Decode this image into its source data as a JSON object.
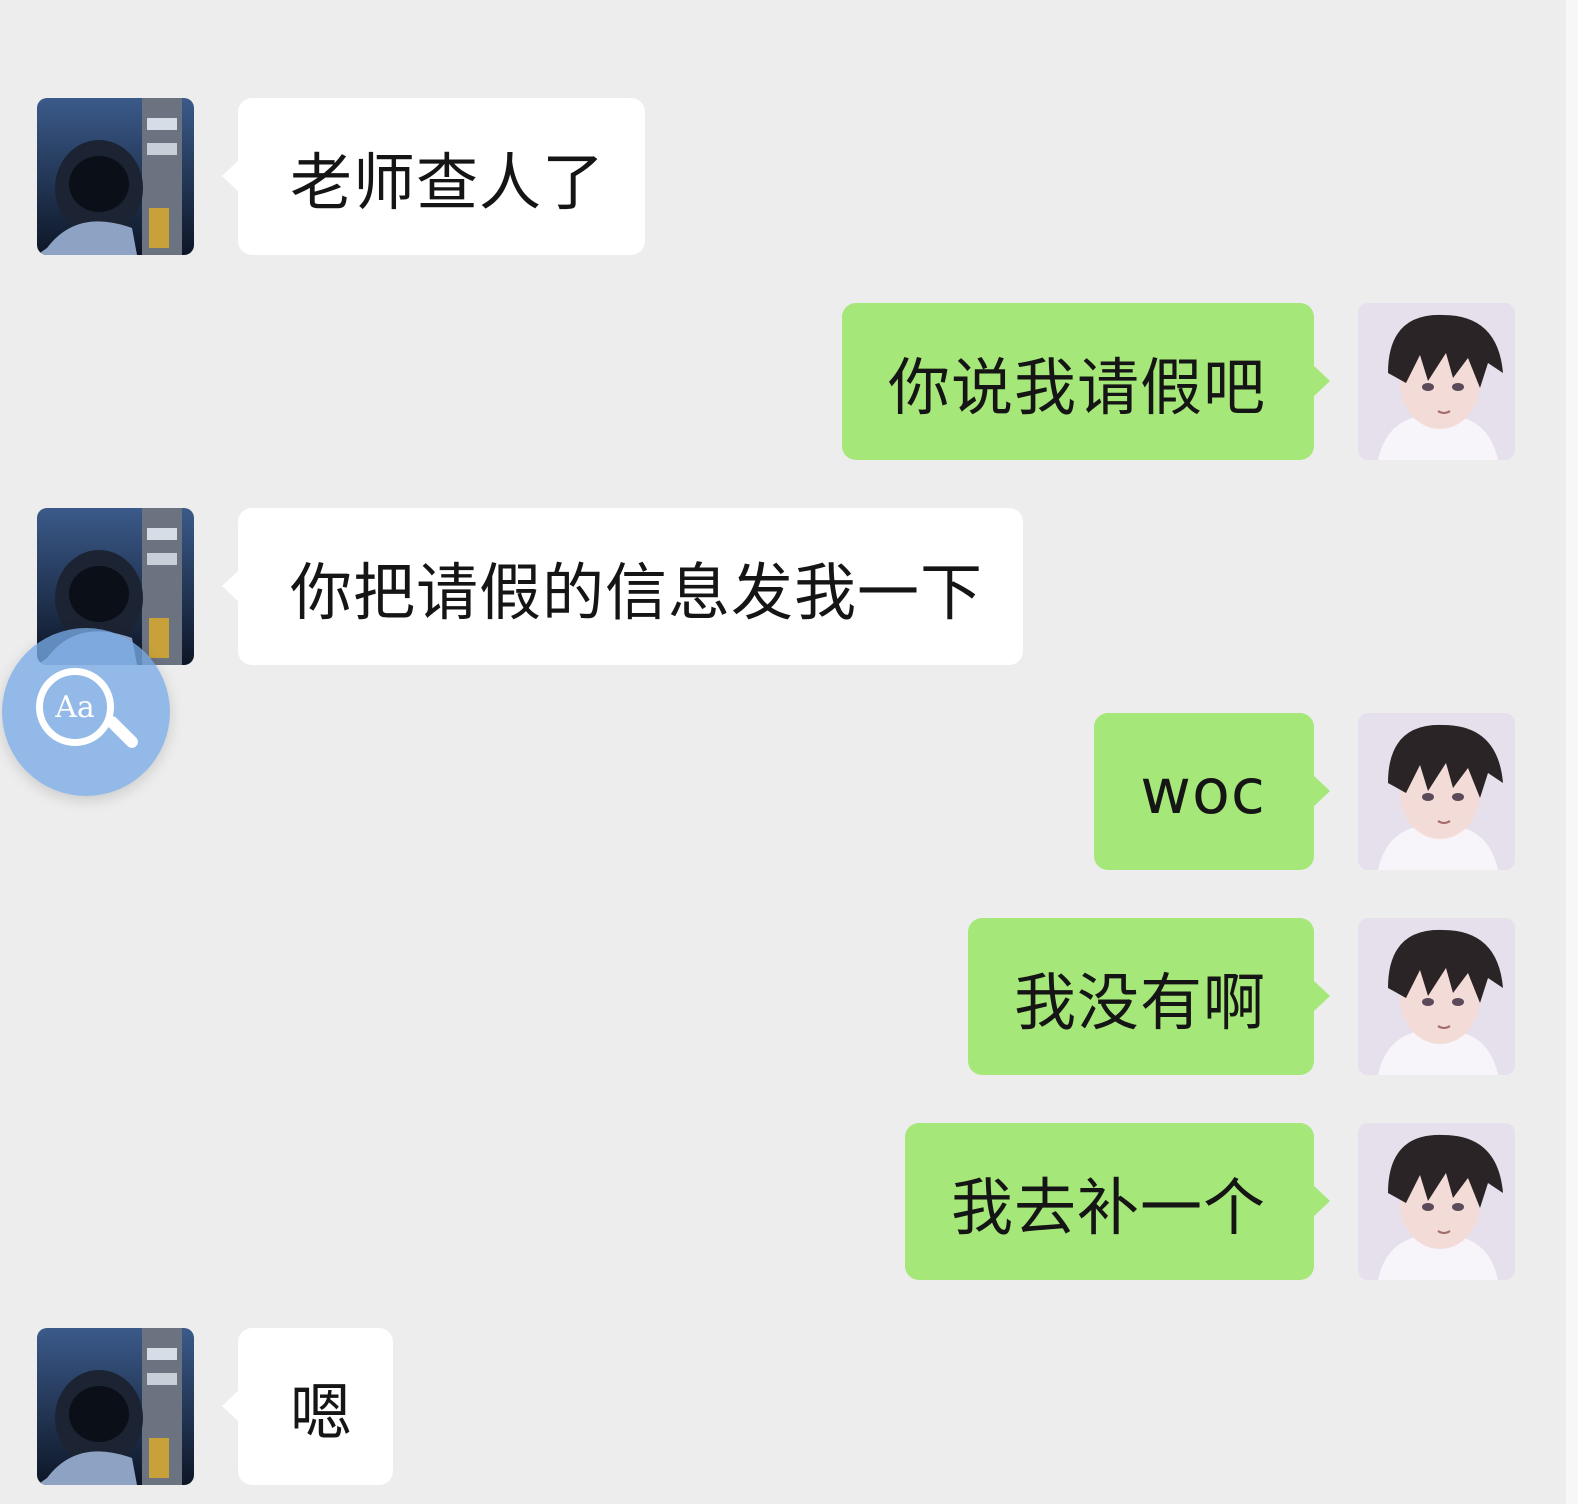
{
  "chat": {
    "messages": [
      {
        "sender": "contact",
        "text": "老师查人了"
      },
      {
        "sender": "me",
        "text": "你说我请假吧"
      },
      {
        "sender": "contact",
        "text": "你把请假的信息发我一下"
      },
      {
        "sender": "me",
        "text": "woc"
      },
      {
        "sender": "me",
        "text": "我没有啊"
      },
      {
        "sender": "me",
        "text": "我去补一个"
      },
      {
        "sender": "contact",
        "text": "嗯"
      }
    ]
  },
  "floating_button": {
    "label": "Aa",
    "icon": "text-search-icon"
  },
  "colors": {
    "background": "#ededed",
    "incoming_bubble": "#ffffff",
    "outgoing_bubble": "#a6e779",
    "float_button": "#78aae6"
  },
  "avatars": {
    "contact": "astronaut-avatar",
    "me": "anime-boy-avatar"
  }
}
